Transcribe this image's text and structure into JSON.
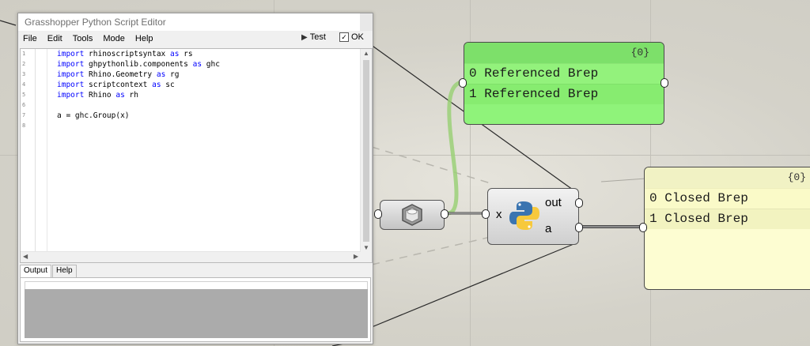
{
  "editor": {
    "title": "Grasshopper Python Script Editor",
    "menu": [
      "File",
      "Edit",
      "Tools",
      "Mode",
      "Help"
    ],
    "test_label": "Test",
    "ok_label": "OK",
    "line_numbers": [
      "1",
      "2",
      "3",
      "4",
      "5",
      "6",
      "7",
      "8"
    ],
    "code_lines": [
      {
        "kw1": "import",
        "mid": " rhinoscriptsyntax ",
        "kw2": "as",
        "end": " rs"
      },
      {
        "kw1": "import",
        "mid": " ghpythonlib.components ",
        "kw2": "as",
        "end": " ghc"
      },
      {
        "kw1": "import",
        "mid": " Rhino.Geometry ",
        "kw2": "as",
        "end": " rg"
      },
      {
        "kw1": "import",
        "mid": " scriptcontext ",
        "kw2": "as",
        "end": " sc"
      },
      {
        "kw1": "import",
        "mid": " Rhino ",
        "kw2": "as",
        "end": " rh"
      },
      {
        "kw1": "",
        "mid": "",
        "kw2": "",
        "end": ""
      },
      {
        "kw1": "",
        "mid": "a = ghc.Group(x)",
        "kw2": "",
        "end": ""
      },
      {
        "kw1": "",
        "mid": "",
        "kw2": "",
        "end": ""
      }
    ],
    "output_tabs": [
      "Output",
      "Help"
    ]
  },
  "ref_panel": {
    "header": "{0}",
    "rows": [
      {
        "index": "0",
        "text": "Referenced Brep"
      },
      {
        "index": "1",
        "text": "Referenced Brep"
      }
    ],
    "color": "#8ff37a"
  },
  "closed_panel": {
    "header": "{0}",
    "rows": [
      {
        "index": "0",
        "text": "Closed Brep"
      },
      {
        "index": "1",
        "text": "Closed Brep"
      }
    ],
    "color": "#fdfdd2"
  },
  "python_component": {
    "input": "x",
    "outputs": [
      "out",
      "a"
    ],
    "icon": "python-logo-icon"
  },
  "brep_param": {
    "icon": "brep-param-icon"
  }
}
